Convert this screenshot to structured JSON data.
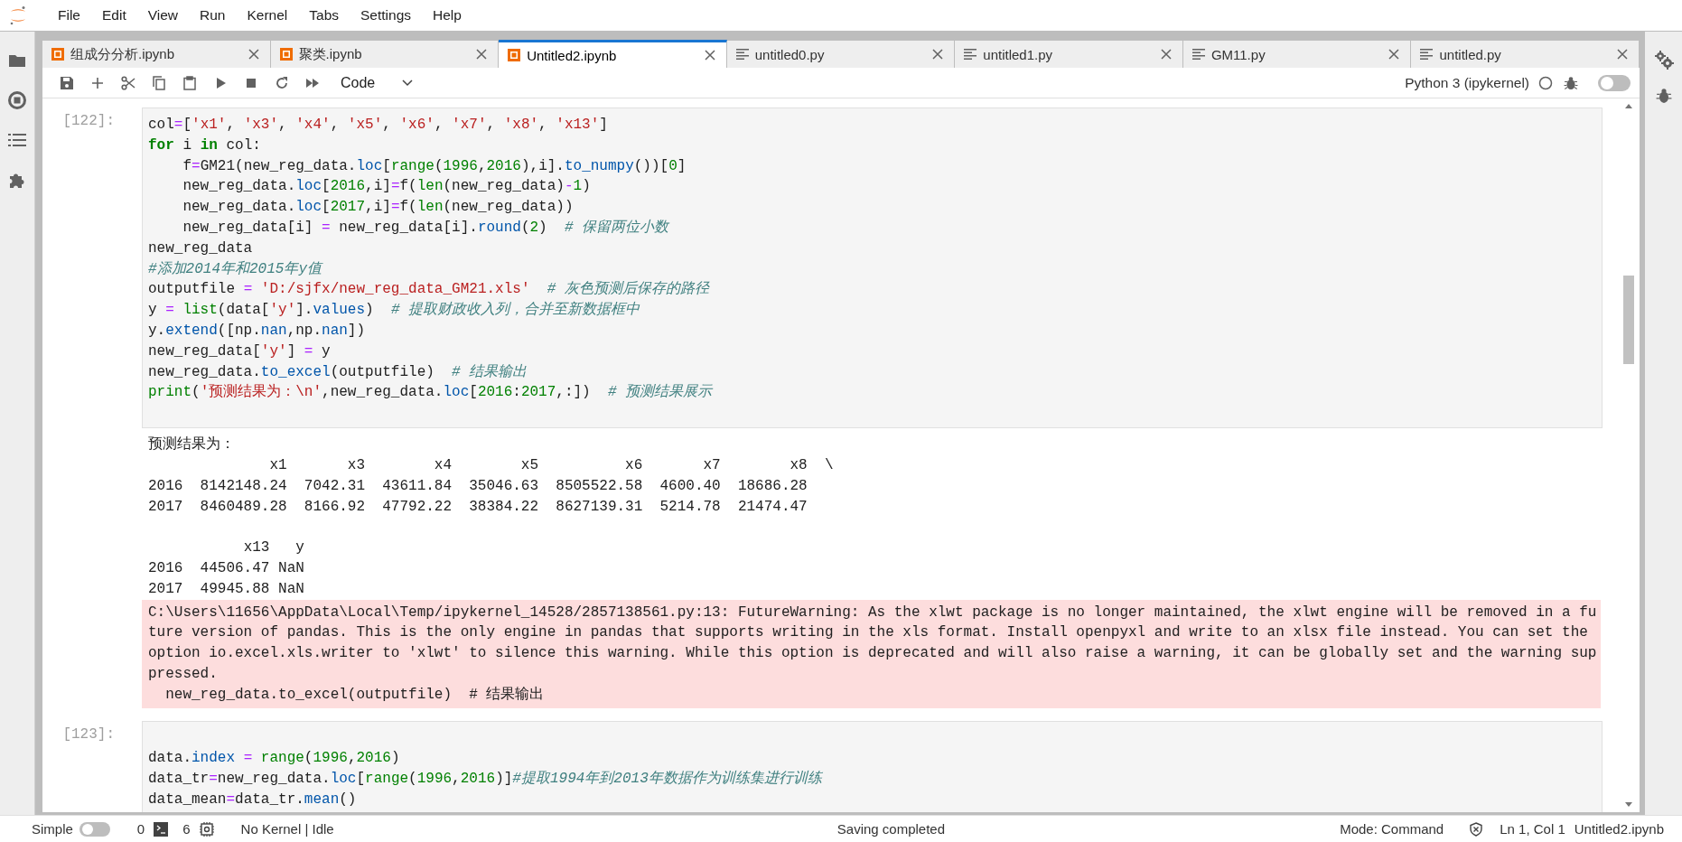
{
  "menu": [
    "File",
    "Edit",
    "View",
    "Run",
    "Kernel",
    "Tabs",
    "Settings",
    "Help"
  ],
  "tabs": [
    {
      "label": "组成分分析.ipynb",
      "kind": "notebook",
      "selected": false
    },
    {
      "label": "聚类.ipynb",
      "kind": "notebook",
      "selected": false
    },
    {
      "label": "Untitled2.ipynb",
      "kind": "notebook",
      "selected": true
    },
    {
      "label": "untitled0.py",
      "kind": "text",
      "selected": false
    },
    {
      "label": "untitled1.py",
      "kind": "text",
      "selected": false
    },
    {
      "label": "GM11.py",
      "kind": "text",
      "selected": false
    },
    {
      "label": "untitled.py",
      "kind": "text",
      "selected": false
    }
  ],
  "toolbar": {
    "cell_type": "Code",
    "kernel": "Python 3 (ipykernel)",
    "kernel_busy": false,
    "debugger_on": false
  },
  "cells": [
    {
      "prompt": "[122]:",
      "lines": [
        [
          "col",
          {
            "kind": "operator",
            "text": "="
          },
          "[",
          {
            "kind": "string",
            "text": "'x1'"
          },
          ", ",
          {
            "kind": "string",
            "text": "'x3'"
          },
          ", ",
          {
            "kind": "string",
            "text": "'x4'"
          },
          ", ",
          {
            "kind": "string",
            "text": "'x5'"
          },
          ", ",
          {
            "kind": "string",
            "text": "'x6'"
          },
          ", ",
          {
            "kind": "string",
            "text": "'x7'"
          },
          ", ",
          {
            "kind": "string",
            "text": "'x8'"
          },
          ", ",
          {
            "kind": "string",
            "text": "'x13'"
          },
          "]"
        ],
        [
          {
            "kind": "keyword",
            "text": "for"
          },
          " i ",
          {
            "kind": "keyword",
            "text": "in"
          },
          " col:"
        ],
        [
          "    f",
          {
            "kind": "operator",
            "text": "="
          },
          "GM21(new_reg_data.",
          {
            "kind": "attribute",
            "text": "loc"
          },
          "[",
          {
            "kind": "builtin",
            "text": "range"
          },
          "(",
          {
            "kind": "number",
            "text": "1996"
          },
          ",",
          {
            "kind": "number",
            "text": "2016"
          },
          "),i].",
          {
            "kind": "attribute",
            "text": "to_numpy"
          },
          "())[",
          {
            "kind": "number",
            "text": "0"
          },
          "]"
        ],
        [
          "    new_reg_data.",
          {
            "kind": "attribute",
            "text": "loc"
          },
          "[",
          {
            "kind": "number",
            "text": "2016"
          },
          ",i]",
          {
            "kind": "operator",
            "text": "="
          },
          "f(",
          {
            "kind": "builtin",
            "text": "len"
          },
          "(new_reg_data)",
          {
            "kind": "operator",
            "text": "-"
          },
          {
            "kind": "number",
            "text": "1"
          },
          ")"
        ],
        [
          "    new_reg_data.",
          {
            "kind": "attribute",
            "text": "loc"
          },
          "[",
          {
            "kind": "number",
            "text": "2017"
          },
          ",i]",
          {
            "kind": "operator",
            "text": "="
          },
          "f(",
          {
            "kind": "builtin",
            "text": "len"
          },
          "(new_reg_data))"
        ],
        [
          "    new_reg_data[i] ",
          {
            "kind": "operator",
            "text": "="
          },
          " new_reg_data[i].",
          {
            "kind": "attribute",
            "text": "round"
          },
          "(",
          {
            "kind": "number",
            "text": "2"
          },
          ")  ",
          {
            "kind": "comment",
            "text": "# 保留两位小数"
          }
        ],
        [
          "new_reg_data"
        ],
        [
          {
            "kind": "comment",
            "text": "#添加2014年和2015年y值"
          }
        ],
        [
          "outputfile ",
          {
            "kind": "operator",
            "text": "="
          },
          {
            "kind": "string",
            "text": " 'D:/sjfx/new_reg_data_GM21.xls'"
          },
          {
            "kind": "comment",
            "text": "  # 灰色预测后保存的路径"
          }
        ],
        [
          "y ",
          {
            "kind": "operator",
            "text": "="
          },
          {
            "kind": "builtin",
            "text": " list"
          },
          "(data[",
          {
            "kind": "string",
            "text": "'y'"
          },
          "].",
          {
            "kind": "attribute",
            "text": "values"
          },
          ")  ",
          {
            "kind": "comment",
            "text": "# 提取财政收入列，合并至新数据框中"
          }
        ],
        [
          "y.",
          {
            "kind": "attribute",
            "text": "extend"
          },
          "([np.",
          {
            "kind": "attribute",
            "text": "nan"
          },
          ",np.",
          {
            "kind": "attribute",
            "text": "nan"
          },
          "])"
        ],
        [
          "new_reg_data[",
          {
            "kind": "string",
            "text": "'y'"
          },
          "] ",
          {
            "kind": "operator",
            "text": "="
          },
          " y"
        ],
        [
          "new_reg_data.",
          {
            "kind": "attribute",
            "text": "to_excel"
          },
          "(outputfile)  ",
          {
            "kind": "comment",
            "text": "# 结果输出"
          }
        ],
        [
          {
            "kind": "builtin",
            "text": "print"
          },
          "(",
          {
            "kind": "string",
            "text": "'预测结果为：\\n'"
          },
          ",new_reg_data.",
          {
            "kind": "attribute",
            "text": "loc"
          },
          "[",
          {
            "kind": "number",
            "text": "2016"
          },
          ":",
          {
            "kind": "number",
            "text": "2017"
          },
          ",:])  ",
          {
            "kind": "comment",
            "text": "# 预测结果展示"
          }
        ]
      ],
      "outputs": [
        {
          "kind": "stdout",
          "text": "预测结果为：\n              x1       x3        x4        x5          x6       x7        x8  \\\n2016  8142148.24  7042.31  43611.84  35046.63  8505522.58  4600.40  18686.28   \n2017  8460489.28  8166.92  47792.22  38384.22  8627139.31  5214.78  21474.47   \n\n           x13   y\n2016  44506.47 NaN\n2017  49945.88 NaN"
        },
        {
          "kind": "stderr",
          "text": "C:\\Users\\11656\\AppData\\Local\\Temp/ipykernel_14528/2857138561.py:13: FutureWarning: As the xlwt package is no longer maintained, the xlwt engine will be removed in a future version of pandas. This is the only engine in pandas that supports writing in the xls format. Install openpyxl and write to an xlsx file instead. You can set the option io.excel.xls.writer to 'xlwt' to silence this warning. While this option is deprecated and will also raise a warning, it can be globally set and the warning suppressed.\n  new_reg_data.to_excel(outputfile)  # 结果输出"
        }
      ]
    },
    {
      "prompt": "[123]:",
      "blank_first_line": true,
      "lines": [
        [
          "data.",
          {
            "kind": "attribute",
            "text": "index"
          },
          {
            "kind": "operator",
            "text": " = "
          },
          {
            "kind": "builtin",
            "text": "range"
          },
          "(",
          {
            "kind": "number",
            "text": "1996"
          },
          ",",
          {
            "kind": "number",
            "text": "2016"
          },
          ")"
        ],
        [
          "data_tr",
          {
            "kind": "operator",
            "text": "="
          },
          "new_reg_data.",
          {
            "kind": "attribute",
            "text": "loc"
          },
          "[",
          {
            "kind": "builtin",
            "text": "range"
          },
          "(",
          {
            "kind": "number",
            "text": "1996"
          },
          ",",
          {
            "kind": "number",
            "text": "2016"
          },
          ")]",
          {
            "kind": "comment",
            "text": "#提取1994年到2013年数据作为训练集进行训练"
          }
        ],
        [
          "data_mean",
          {
            "kind": "operator",
            "text": "="
          },
          "data_tr.",
          {
            "kind": "attribute",
            "text": "mean"
          },
          "()"
        ]
      ]
    }
  ],
  "status_bar": {
    "simple_label": "Simple",
    "simple_mode": false,
    "terminals": "0",
    "kernels": "6",
    "kernel_status": "No Kernel | Idle",
    "message": "Saving completed",
    "mode": "Mode: Command",
    "position": "Ln 1, Col 1",
    "file": "Untitled2.ipynb"
  }
}
